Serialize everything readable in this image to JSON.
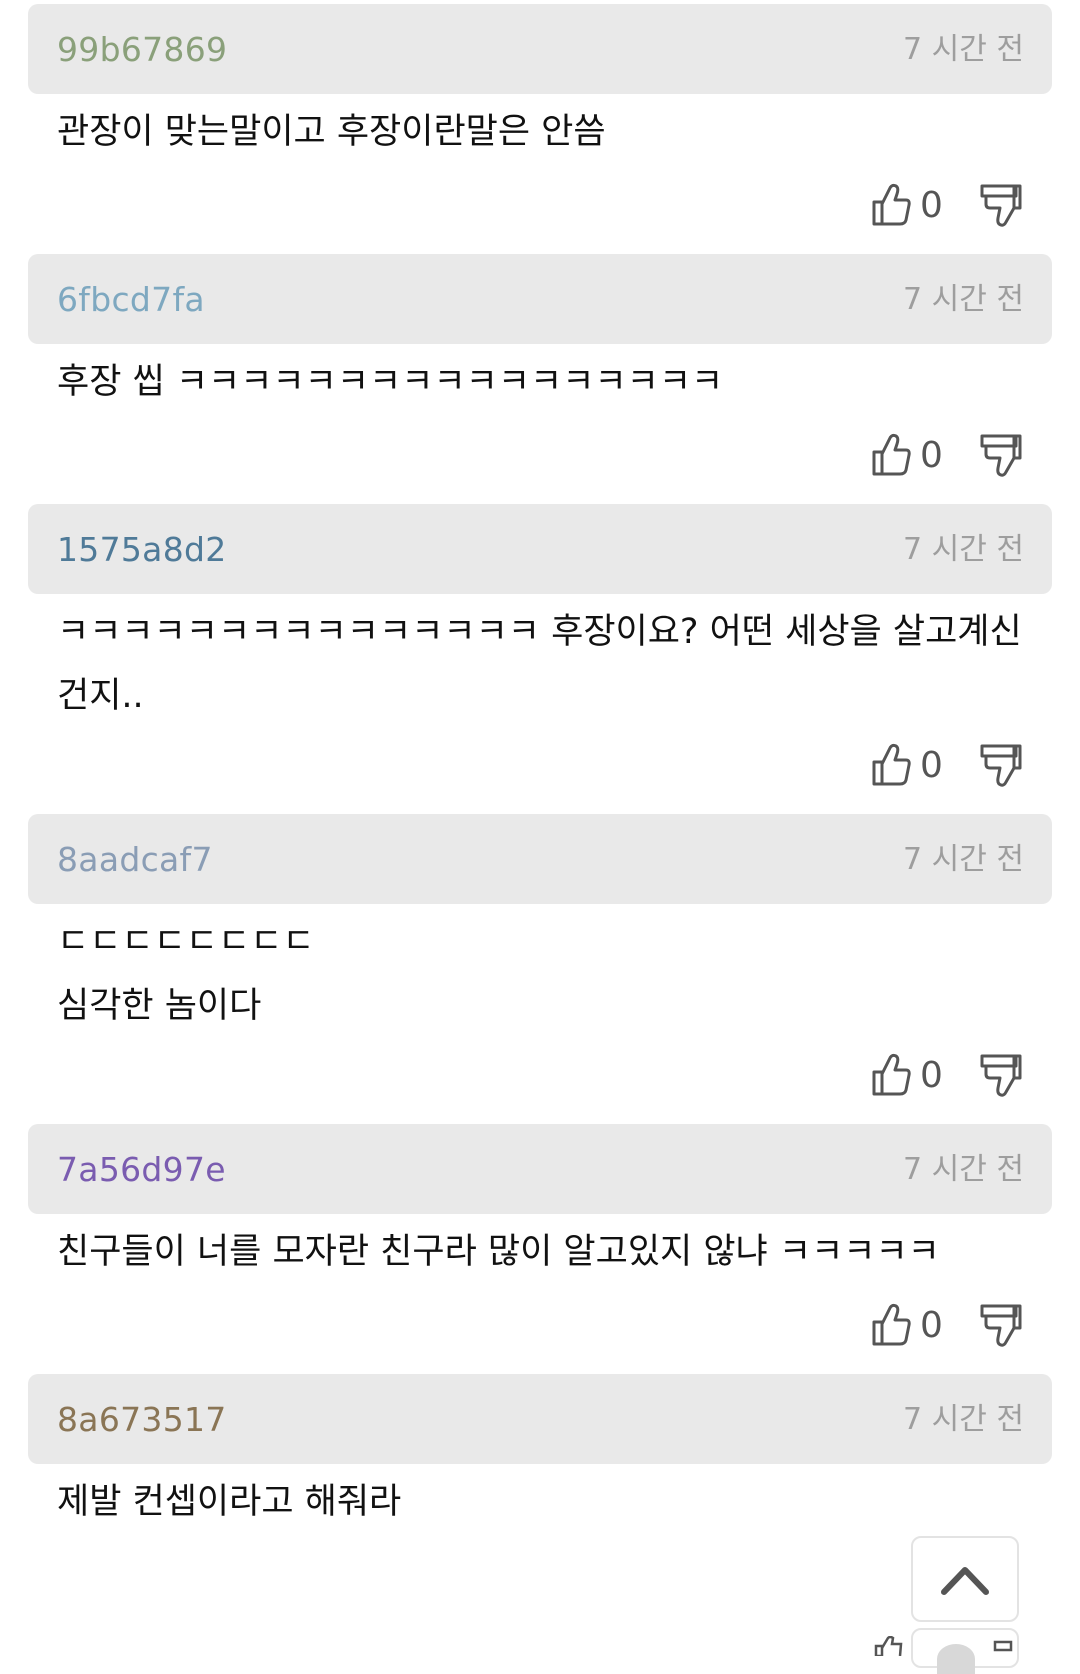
{
  "comments": [
    {
      "author": "99b67869",
      "author_color": "#8aa07a",
      "time": "7 시간 전",
      "text": "관장이 맞는말이고 후장이란말은 안씀",
      "likes": "0"
    },
    {
      "author": "6fbcd7fa",
      "author_color": "#7ea8c0",
      "time": "7 시간 전",
      "text": "후장 씹 ㅋㅋㅋㅋㅋㅋㅋㅋㅋㅋㅋㅋㅋㅋㅋㅋㅋ",
      "likes": "0"
    },
    {
      "author": "1575a8d2",
      "author_color": "#4f7a98",
      "time": "7 시간 전",
      "text": "ㅋㅋㅋㅋㅋㅋㅋㅋㅋㅋㅋㅋㅋㅋㅋ 후장이요? 어떤 세상을 살고계신건지..",
      "likes": "0"
    },
    {
      "author": "8aadcaf7",
      "author_color": "#8a9db5",
      "time": "7 시간 전",
      "text": "ㄷㄷㄷㄷㄷㄷㄷㄷ\n심각한 놈이다",
      "likes": "0"
    },
    {
      "author": "7a56d97e",
      "author_color": "#7a5cb0",
      "time": "7 시간 전",
      "text": "친구들이 너를 모자란 친구라 많이 알고있지 않냐 ㅋㅋㅋㅋㅋ",
      "likes": "0"
    },
    {
      "author": "8a673517",
      "author_color": "#8a7555",
      "time": "7 시간 전",
      "text": "제발 컨셉이라고 해줘라",
      "likes": ""
    }
  ],
  "icons": {
    "like": "thumbs-up-icon",
    "dislike": "thumbs-down-icon",
    "scroll_top": "chevron-up-icon"
  }
}
